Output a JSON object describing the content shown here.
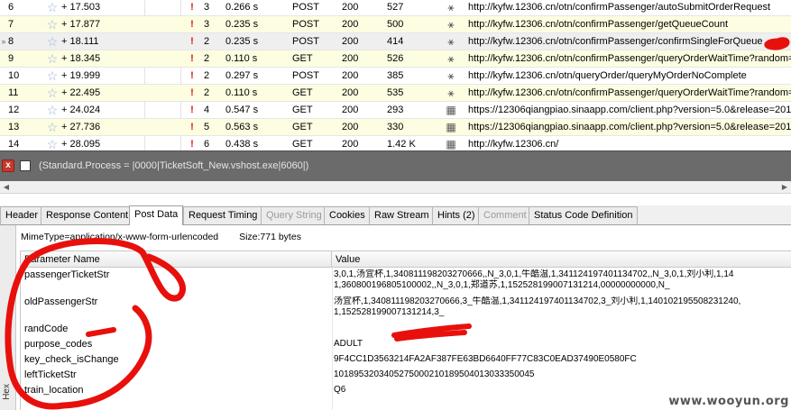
{
  "sessions": [
    {
      "num": "6",
      "elapsed": "+ 17.503",
      "count": "3",
      "duration": "0.266 s",
      "method": "POST",
      "status": "200",
      "size": "527",
      "url": "http://kyfw.12306.cn/otn/confirmPassenger/autoSubmitOrderRequest",
      "icon": "post-icon",
      "alt": false,
      "selected": false
    },
    {
      "num": "7",
      "elapsed": "+ 17.877",
      "count": "3",
      "duration": "0.235 s",
      "method": "POST",
      "status": "200",
      "size": "500",
      "url": "http://kyfw.12306.cn/otn/confirmPassenger/getQueueCount",
      "icon": "post-icon",
      "alt": true,
      "selected": false
    },
    {
      "num": "8",
      "elapsed": "+ 18.111",
      "count": "2",
      "duration": "0.235 s",
      "method": "POST",
      "status": "200",
      "size": "414",
      "url": "http://kyfw.12306.cn/otn/confirmPassenger/confirmSingleForQueue",
      "icon": "post-icon",
      "alt": false,
      "selected": true
    },
    {
      "num": "9",
      "elapsed": "+ 18.345",
      "count": "2",
      "duration": "0.110 s",
      "method": "GET",
      "status": "200",
      "size": "526",
      "url": "http://kyfw.12306.cn/otn/confirmPassenger/queryOrderWaitTime?random=",
      "icon": "get-icon",
      "alt": true,
      "selected": false
    },
    {
      "num": "10",
      "elapsed": "+ 19.999",
      "count": "2",
      "duration": "0.297 s",
      "method": "POST",
      "status": "200",
      "size": "385",
      "url": "http://kyfw.12306.cn/otn/queryOrder/queryMyOrderNoComplete",
      "icon": "post-icon",
      "alt": false,
      "selected": false
    },
    {
      "num": "11",
      "elapsed": "+ 22.495",
      "count": "2",
      "duration": "0.110 s",
      "method": "GET",
      "status": "200",
      "size": "535",
      "url": "http://kyfw.12306.cn/otn/confirmPassenger/queryOrderWaitTime?random=",
      "icon": "get-icon",
      "alt": true,
      "selected": false
    },
    {
      "num": "12",
      "elapsed": "+ 24.024",
      "count": "4",
      "duration": "0.547 s",
      "method": "GET",
      "status": "200",
      "size": "293",
      "url": "https://12306qiangpiao.sinaapp.com/client.php?version=5.0&release=2013",
      "icon": "page-icon",
      "alt": false,
      "selected": false
    },
    {
      "num": "13",
      "elapsed": "+ 27.736",
      "count": "5",
      "duration": "0.563 s",
      "method": "GET",
      "status": "200",
      "size": "330",
      "url": "https://12306qiangpiao.sinaapp.com/client.php?version=5.0&release=2013",
      "icon": "page-icon",
      "alt": true,
      "selected": false
    },
    {
      "num": "14",
      "elapsed": "+ 28.095",
      "count": "6",
      "duration": "0.438 s",
      "method": "GET",
      "status": "200",
      "size": "1.42 K",
      "url": "http://kyfw.12306.cn/",
      "icon": "page-icon",
      "alt": false,
      "selected": false
    }
  ],
  "filter": {
    "close_label": "x",
    "expression": "(Standard.Process = |0000|TicketSoft_New.vshost.exe|6060|)"
  },
  "tabs": [
    {
      "label": "Header",
      "state": "normal"
    },
    {
      "label": "Response Content",
      "state": "normal"
    },
    {
      "label": "Post Data",
      "state": "active"
    },
    {
      "label": "Request Timing",
      "state": "normal"
    },
    {
      "label": "Query String",
      "state": "disabled"
    },
    {
      "label": "Cookies",
      "state": "normal"
    },
    {
      "label": "Raw Stream",
      "state": "normal"
    },
    {
      "label": "Hints (2)",
      "state": "normal"
    },
    {
      "label": "Comment",
      "state": "disabled"
    },
    {
      "label": "Status Code Definition",
      "state": "normal"
    }
  ],
  "inspector": {
    "hex_label": "Hex",
    "mime": "MimeType=application/x-www-form-urlencoded",
    "size": "Size:771 bytes",
    "col_name": "Parameter Name",
    "col_value": "Value",
    "params": [
      {
        "name": "passengerTicketStr",
        "value": "3,0,1,汤宜杯,1,340811198203270666,,N_3,0,1,牛酷温,1,341124197401134702,,N_3,0,1,刘小利,1,14\n1,360800196805100002,,N_3,0,1,郑道苏,1,152528199007131214,00000000000,N_"
      },
      {
        "name": "oldPassengerStr",
        "value": "汤宜杯,1,340811198203270666,3_牛酷温,1,341124197401134702,3_刘小利,1,140102195508231240,\n1,152528199007131214,3_"
      },
      {
        "name": "randCode",
        "value": ""
      },
      {
        "name": "purpose_codes",
        "value": "ADULT"
      },
      {
        "name": "key_check_isChange",
        "value": "9F4CC1D3563214FA2AF387FE63BD6640FF77C83C0EAD37490E0580FC"
      },
      {
        "name": "leftTicketStr",
        "value": "1018953203405275000210189504013033350045"
      },
      {
        "name": "train_location",
        "value": "Q6"
      }
    ]
  },
  "watermark": "www.wooyun.org",
  "colors": {
    "annotation": "#e8100c",
    "alert": "#d81b0c",
    "filter_bg": "#6b6b6b"
  }
}
